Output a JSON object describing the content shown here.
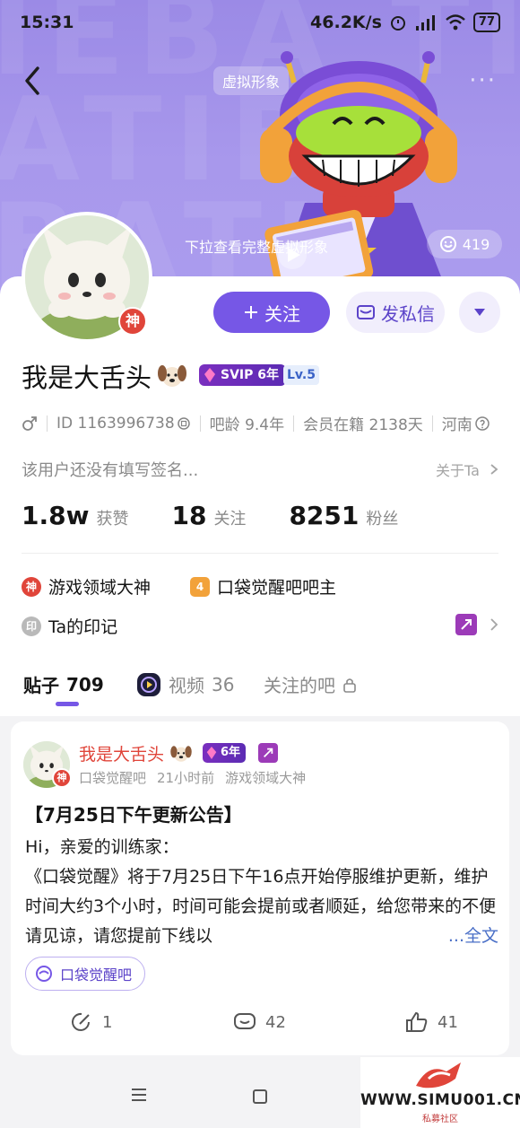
{
  "status_bar": {
    "time": "15:31",
    "speed": "46.2K/s",
    "battery": "77"
  },
  "banner": {
    "tag": "虚拟形象",
    "pull_hint": "下拉查看完整虚拟形象",
    "like_count": "419"
  },
  "profile": {
    "follow_label": "关注",
    "message_label": "发私信",
    "god_badge": "神",
    "username": "我是大舌头",
    "svip": "SVIP 6年",
    "level": "Lv.5",
    "id_text": "ID 1163996738",
    "tieba_age": "吧龄 9.4年",
    "member_days": "会员在籍 2138天",
    "location": "河南",
    "signature": "该用户还没有填写签名...",
    "about": "关于Ta"
  },
  "stats": [
    {
      "value": "1.8w",
      "label": "获赞"
    },
    {
      "value": "18",
      "label": "关注"
    },
    {
      "value": "8251",
      "label": "粉丝"
    }
  ],
  "honors": [
    {
      "badge": "神",
      "label": "游戏领域大神",
      "color": "#e0453a"
    },
    {
      "badge": "4",
      "label": "口袋觉醒吧吧主",
      "color": "#f2a23a"
    }
  ],
  "marks": {
    "badge": "印",
    "label": "Ta的印记"
  },
  "tabs": [
    {
      "label": "贴子",
      "count": "709"
    },
    {
      "label": "视频",
      "count": "36"
    },
    {
      "label": "关注的吧",
      "count": ""
    }
  ],
  "post": {
    "author": "我是大舌头",
    "vip": "6年",
    "forum_src": "口袋觉醒吧",
    "time": "21小时前",
    "field": "游戏领域大神",
    "title": "【7月25日下午更新公告】",
    "greeting": "Hi，亲爱的训练家：",
    "body": "《口袋觉醒》将于7月25日下午16点开始停服维护更新，维护时间大约3个小时，时间可能会提前或者顺延，给您带来的不便请见谅，请您提前下线以",
    "more": "...全文",
    "forum_tag": "口袋觉醒吧",
    "shares": "1",
    "comments": "42",
    "likes": "41"
  },
  "watermark": {
    "text": "WWW.SIMU001.CN",
    "sub": "私募社区"
  },
  "colors": {
    "accent": "#7657e6",
    "god_red": "#e0453a",
    "banner": "#a898ec"
  }
}
